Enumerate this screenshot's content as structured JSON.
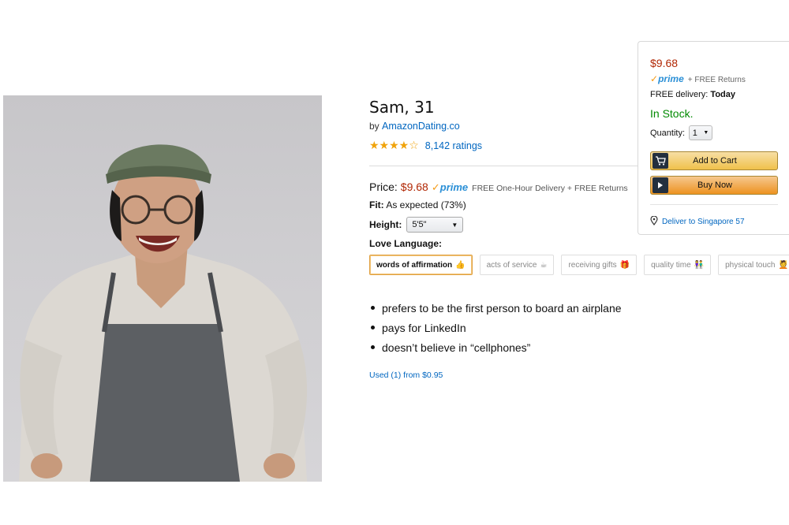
{
  "product": {
    "title": "Sam, 31",
    "by_prefix": "by",
    "brand": "AmazonDating.co",
    "stars": "★★★★☆",
    "rating_count": "8,142 ratings",
    "price_label": "Price:",
    "price": "$9.68",
    "prime_check": "✓",
    "prime_word": "prime",
    "delivery_note": "FREE One-Hour Delivery + FREE Returns",
    "fit_label": "Fit:",
    "fit_value": "As expected (73%)",
    "height_label": "Height:",
    "height_value": "5'5\"",
    "love_language_label": "Love Language:",
    "love_languages": [
      {
        "label": "words of affirmation",
        "emoji": "👍",
        "selected": true
      },
      {
        "label": "acts of service",
        "emoji": "☕",
        "selected": false
      },
      {
        "label": "receiving gifts",
        "emoji": "🎁",
        "selected": false
      },
      {
        "label": "quality time",
        "emoji": "👫",
        "selected": false
      },
      {
        "label": "physical touch",
        "emoji": "💆",
        "selected": false
      }
    ],
    "bullets": [
      "prefers to be the first person to board an airplane",
      "pays for LinkedIn",
      "doesn’t believe in “cellphones”"
    ],
    "used_offer": "Used (1) from $0.95"
  },
  "buybox": {
    "price": "$9.68",
    "prime_check": "✓",
    "prime_word": "prime",
    "returns": "+ FREE Returns",
    "delivery_label": "FREE delivery:",
    "delivery_value": "Today",
    "stock": "In Stock.",
    "quantity_label": "Quantity:",
    "quantity_value": "1",
    "add_to_cart": "Add to Cart",
    "buy_now": "Buy Now",
    "deliver_to": "Deliver to Singapore 57"
  },
  "colors": {
    "price": "#b12704",
    "link": "#0066c0",
    "in_stock": "#008a00",
    "prime_blue": "#2a8fd6",
    "prime_check": "#f49b16",
    "star": "#f0a30a"
  },
  "icons": {
    "cart_button": "cart-icon",
    "buy_button": "play-icon",
    "deliver": "location-pin-icon",
    "dropdown": "chevron-down-icon"
  }
}
